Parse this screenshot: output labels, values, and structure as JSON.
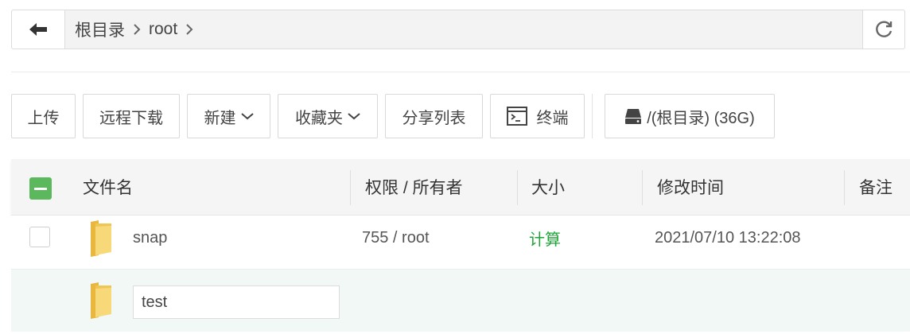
{
  "nav": {
    "back_icon": "arrow-left-icon",
    "breadcrumb": [
      {
        "label": "根目录"
      },
      {
        "label": "root"
      }
    ],
    "refresh_icon": "refresh-icon"
  },
  "toolbar": {
    "upload": "上传",
    "remote_download": "远程下载",
    "new": "新建",
    "favorites": "收藏夹",
    "share_list": "分享列表",
    "terminal": "终端",
    "disk": "/(根目录) (36G)"
  },
  "table": {
    "columns": {
      "name": "文件名",
      "perm_owner": "权限 / 所有者",
      "size": "大小",
      "mtime": "修改时间",
      "note": "备注"
    },
    "rows": [
      {
        "name": "snap",
        "perm_owner": "755 / root",
        "size": "计算",
        "mtime": "2021/07/10 13:22:08"
      }
    ],
    "new_item": {
      "value": "test"
    }
  },
  "colors": {
    "accent_green": "#20a53a",
    "check_green": "#5cb85c",
    "folder_yellow": "#f5d36b"
  }
}
